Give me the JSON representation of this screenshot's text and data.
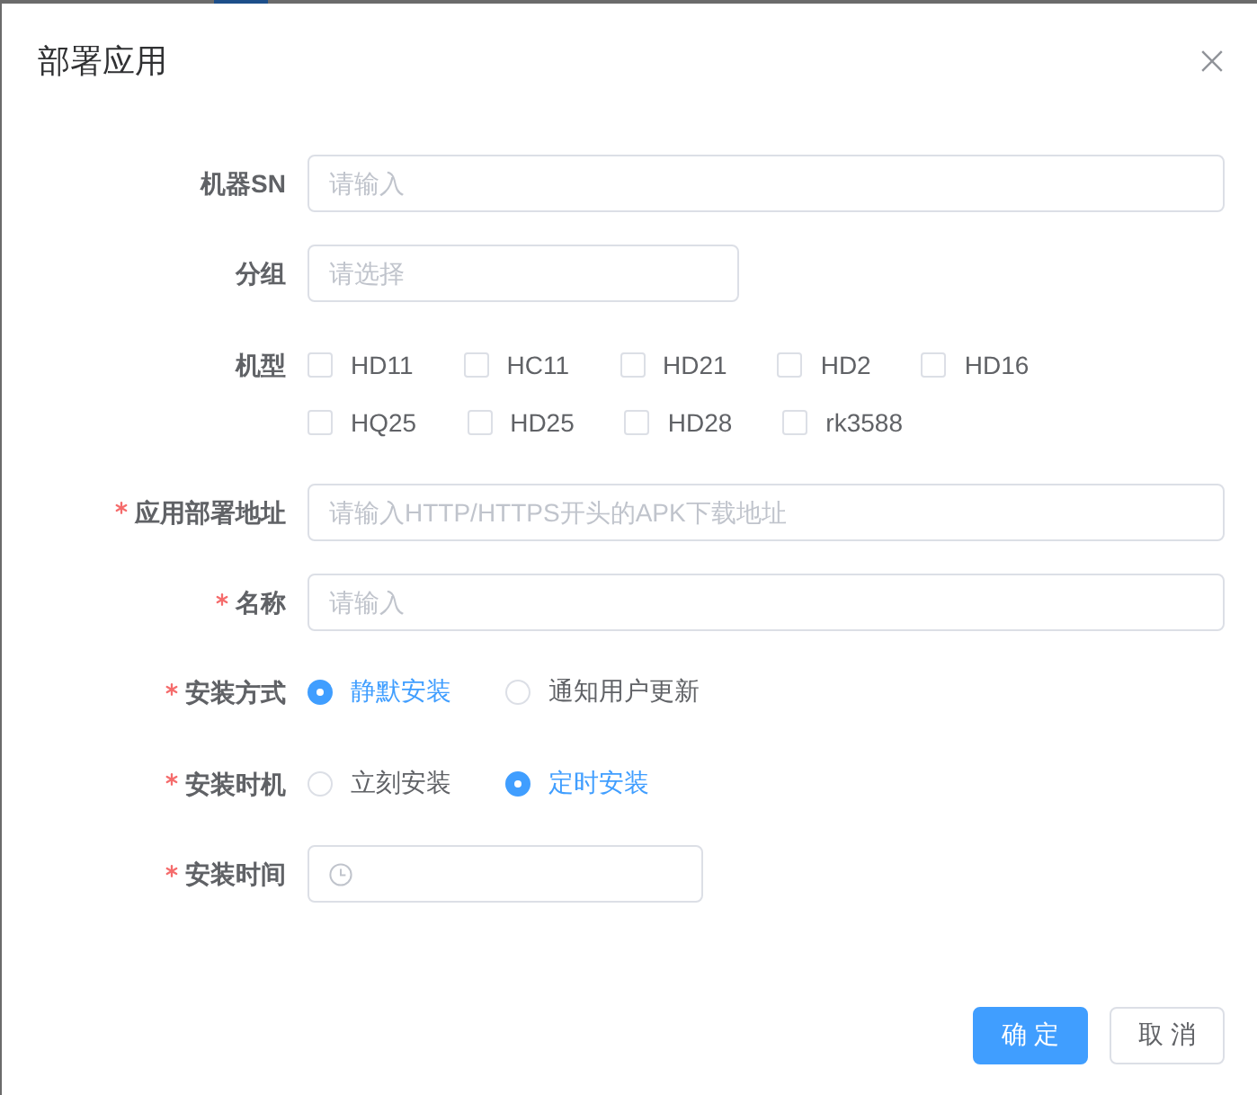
{
  "dialog": {
    "title": "部署应用"
  },
  "form": {
    "fields": [
      {
        "kind": "input",
        "label": "机器SN",
        "required": false,
        "placeholder": "请输入"
      },
      {
        "kind": "select",
        "label": "分组",
        "required": false,
        "placeholder": "请选择"
      },
      {
        "kind": "checkboxes",
        "label": "机型",
        "required": false,
        "options": [
          {
            "label": "HD11",
            "checked": false
          },
          {
            "label": "HC11",
            "checked": false
          },
          {
            "label": "HD21",
            "checked": false
          },
          {
            "label": "HD2",
            "checked": false
          },
          {
            "label": "HD16",
            "checked": false
          },
          {
            "label": "HQ25",
            "checked": false
          },
          {
            "label": "HD25",
            "checked": false
          },
          {
            "label": "HD28",
            "checked": false
          },
          {
            "label": "rk3588",
            "checked": false
          }
        ]
      },
      {
        "kind": "input",
        "label": "应用部署地址",
        "required": true,
        "placeholder": "请输入HTTP/HTTPS开头的APK下载地址"
      },
      {
        "kind": "input",
        "label": "名称",
        "required": true,
        "placeholder": "请输入"
      },
      {
        "kind": "radios",
        "label": "安装方式",
        "required": true,
        "options": [
          {
            "label": "静默安装",
            "selected": true
          },
          {
            "label": "通知用户更新",
            "selected": false
          }
        ]
      },
      {
        "kind": "radios",
        "label": "安装时机",
        "required": true,
        "options": [
          {
            "label": "立刻安装",
            "selected": false
          },
          {
            "label": "定时安装",
            "selected": true
          }
        ]
      },
      {
        "kind": "time",
        "label": "安装时间",
        "required": true
      }
    ]
  },
  "footer": {
    "buttons": [
      {
        "label": "确 定",
        "kind": "primary"
      },
      {
        "label": "取 消",
        "kind": "default"
      }
    ]
  }
}
